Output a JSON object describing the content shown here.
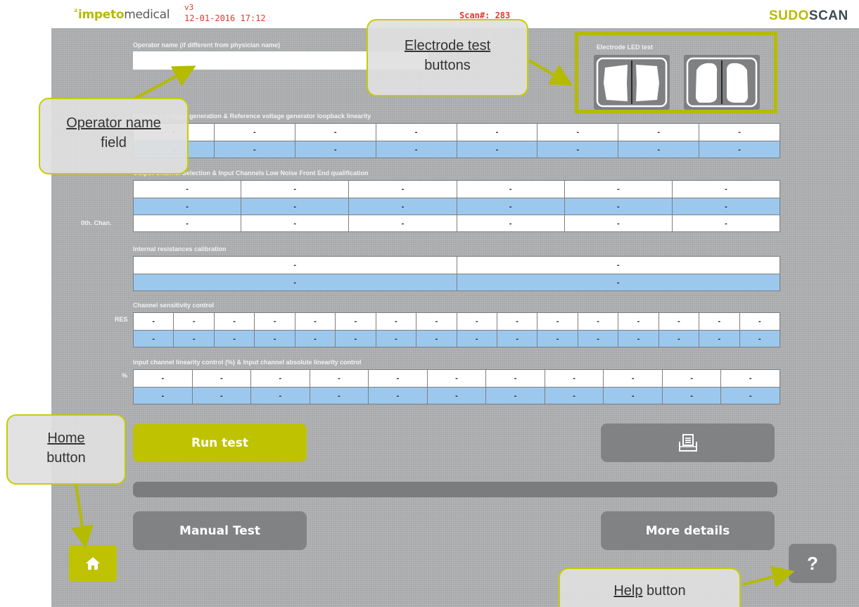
{
  "header": {
    "logo_prefix": "²",
    "logo_part1": "impeto",
    "logo_part2": "medical",
    "version": "v3",
    "datetime": "12-01-2016 17:12",
    "scan": "Scan#: 283",
    "brand_part1": "SUDO",
    "brand_part2": "SCAN"
  },
  "operator": {
    "label": "Operator name (if different from physician name)",
    "value": ""
  },
  "electrode_test": {
    "title": "Electrode LED test"
  },
  "sections": {
    "ref_voltage": {
      "title": "Reference voltage generation & Reference voltage generator loopback linearity",
      "columns": 8,
      "rows": [
        [
          "-",
          "-",
          "-",
          "-",
          "-",
          "-",
          "-",
          "-"
        ],
        [
          "-",
          "-",
          "-",
          "-",
          "-",
          "-",
          "-",
          "-"
        ]
      ]
    },
    "output_channel": {
      "title": "Output Channel Selection & Input Channels Low Noise Front End qualification",
      "side_label": "0th. Chan.",
      "rows": [
        [
          "-",
          "-",
          "-",
          "-",
          "-",
          "-"
        ],
        [
          "-",
          "-",
          "-",
          "-",
          "-",
          "-"
        ],
        [
          "-",
          "-",
          "-",
          "-",
          "-",
          "-"
        ]
      ]
    },
    "internal_res": {
      "title": "Internal resistances calibration",
      "rows": [
        [
          "-",
          "-"
        ],
        [
          "-",
          "-"
        ]
      ]
    },
    "sensitivity": {
      "title": "Channel sensitivity control",
      "side_label": "RES",
      "rows": [
        [
          "-",
          "-",
          "-",
          "-",
          "-",
          "-",
          "-",
          "-",
          "-",
          "-",
          "-",
          "-",
          "-",
          "-",
          "-",
          "-"
        ],
        [
          "-",
          "-",
          "-",
          "-",
          "-",
          "-",
          "-",
          "-",
          "-",
          "-",
          "-",
          "-",
          "-",
          "-",
          "-",
          "-"
        ]
      ]
    },
    "linearity": {
      "title": "Input channel linearity control (%) & Input channel absolute linearity control",
      "side_label": "%",
      "rows": [
        [
          "-",
          "-",
          "-",
          "-",
          "-",
          "-",
          "-",
          "-",
          "-",
          "-",
          "-"
        ],
        [
          "-",
          "-",
          "-",
          "-",
          "-",
          "-",
          "-",
          "-",
          "-",
          "-",
          "-"
        ]
      ]
    }
  },
  "buttons": {
    "run_test": "Run test",
    "print_icon": "print-icon",
    "manual_test": "Manual Test",
    "more_details": "More details",
    "home_icon": "home-icon",
    "help": "?"
  },
  "progress": 0,
  "callouts": {
    "electrode_line1": "Electrode test",
    "electrode_line2": "buttons",
    "operator_line1": "Operator name",
    "operator_line2": "field",
    "home_line1": "Home",
    "home_line2": "button",
    "help_line1": "Help",
    "help_line2": " button"
  },
  "colors": {
    "accent": "#bfc200",
    "button_gray": "#808284",
    "row_blue": "#9cc8ee",
    "panel": "#a6a8aa",
    "header_red": "#e0392a"
  }
}
